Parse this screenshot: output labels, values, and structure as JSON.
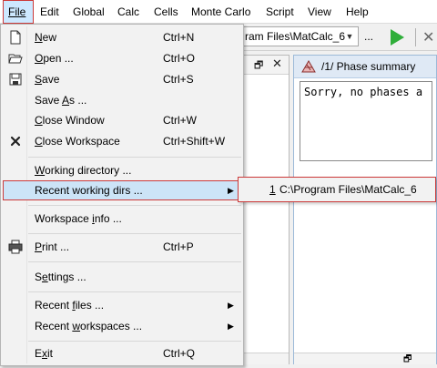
{
  "menubar": {
    "items": [
      "File",
      "Edit",
      "Global",
      "Calc",
      "Cells",
      "Monte Carlo",
      "Script",
      "View",
      "Help"
    ],
    "active": "File"
  },
  "toolbar": {
    "path_value": "ram Files\\MatCalc_6",
    "ellipsis": "...",
    "run_color": "#2fae3a"
  },
  "phase_window": {
    "title": "/1/ Phase summary",
    "content": "Sorry, no phases a"
  },
  "file_menu": {
    "items": [
      {
        "label": "New",
        "shortcut": "Ctrl+N",
        "icon": "new-document-icon"
      },
      {
        "label": "Open ...",
        "shortcut": "Ctrl+O",
        "icon": "open-folder-icon"
      },
      {
        "label": "Save",
        "shortcut": "Ctrl+S",
        "icon": "save-disk-icon"
      },
      {
        "label": "Save As ...",
        "shortcut": ""
      },
      {
        "label": "Close Window",
        "shortcut": "Ctrl+W"
      },
      {
        "label": "Close Workspace",
        "shortcut": "Ctrl+Shift+W",
        "icon": "close-x-icon"
      },
      {
        "label": "Working directory ...",
        "shortcut": ""
      },
      {
        "label": "Recent working dirs ...",
        "shortcut": "",
        "submenu": true
      },
      {
        "label": "Workspace info ...",
        "shortcut": ""
      },
      {
        "label": "Print ...",
        "shortcut": "Ctrl+P",
        "icon": "printer-icon"
      },
      {
        "label": "Settings ...",
        "shortcut": ""
      },
      {
        "label": "Recent files ...",
        "shortcut": "",
        "submenu": true
      },
      {
        "label": "Recent workspaces ...",
        "shortcut": "",
        "submenu": true
      },
      {
        "label": "Exit",
        "shortcut": "Ctrl+Q"
      }
    ],
    "highlighted": "Recent working dirs ..."
  },
  "recent_dirs_submenu": {
    "items": [
      {
        "number": "1",
        "path": "C:\\Program Files\\MatCalc_6"
      }
    ]
  },
  "colors": {
    "highlight_border": "#cc3a3a",
    "highlight_fill": "#cce4f7",
    "menu_bg": "#f2f2f2"
  }
}
